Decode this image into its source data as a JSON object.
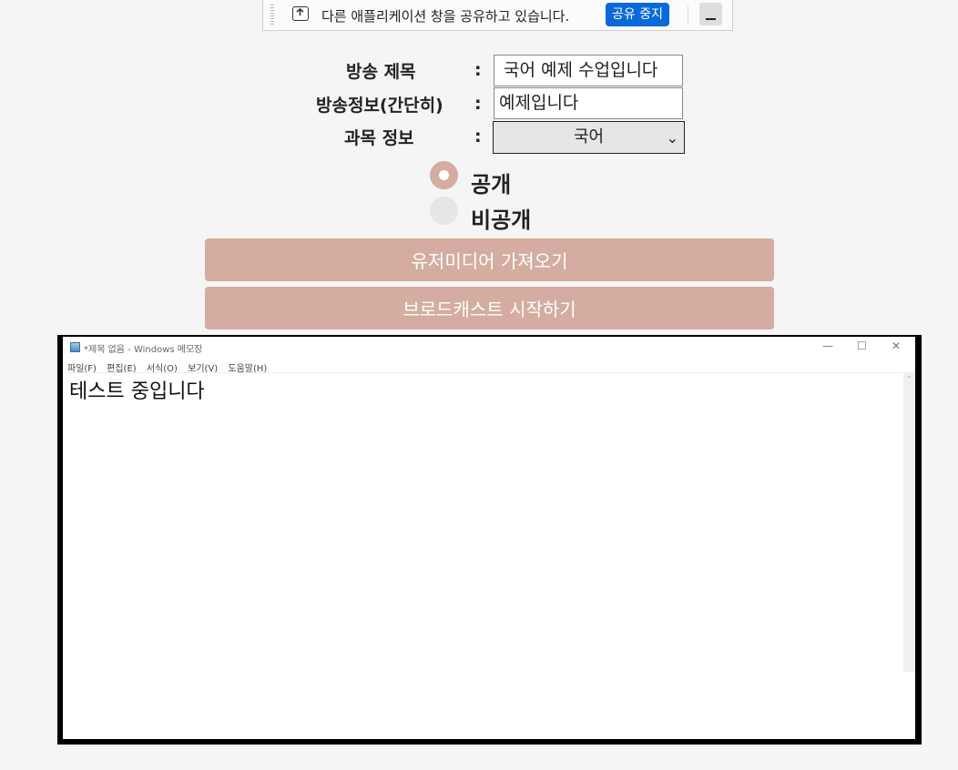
{
  "share_bar": {
    "message": "다른 애플리케이션 창을 공유하고 있습니다.",
    "stop_label": "공유 중지",
    "stop_color": "#0a69d9"
  },
  "form": {
    "title_label": "방송 제목",
    "title_value": "국어 예제 수업입니다",
    "info_label": "방송정보(간단히)",
    "info_value": "예제입니다",
    "subject_label": "과목 정보",
    "subject_value": "국어",
    "colon": ":",
    "visibility_options": [
      {
        "label": "공개",
        "selected": true
      },
      {
        "label": "비공개",
        "selected": false
      }
    ],
    "accent_color": "#d4ada0"
  },
  "buttons": {
    "user_media": "유저미디어 가져오기",
    "start_broadcast": "브로드캐스트 시작하기"
  },
  "notepad": {
    "title": "*제목 없음 - Windows 메모장",
    "menu": [
      "파일(F)",
      "편집(E)",
      "서식(O)",
      "보기(V)",
      "도움말(H)"
    ],
    "content": "테스트 중입니다"
  }
}
